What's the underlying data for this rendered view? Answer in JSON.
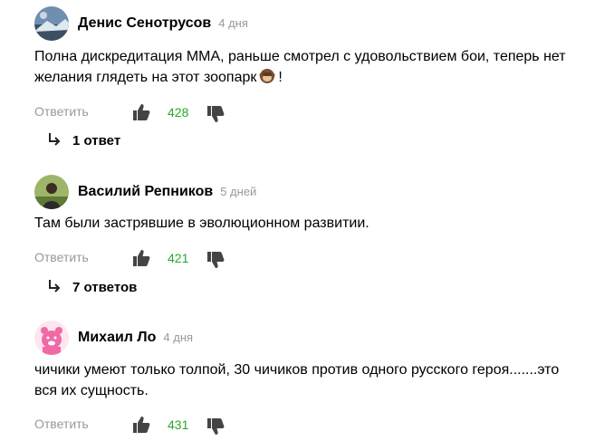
{
  "comments": [
    {
      "author": "Денис Сенотрусов",
      "time": "4 дня",
      "text": "Полна дискредитация ММА, раньше смотрел с удовольствием бои, теперь нет желания глядеть на этот зоопарк",
      "text_suffix": "!",
      "emoji": "monkey-emoji",
      "reply_label": "Ответить",
      "likes": "428",
      "replies_label": "1 ответ"
    },
    {
      "author": "Василий Репников",
      "time": "5 дней",
      "text": "Там были застрявшие в эволюционном развитии.",
      "reply_label": "Ответить",
      "likes": "421",
      "replies_label": "7 ответов"
    },
    {
      "author": "Михаил Ло",
      "time": "4 дня",
      "text": "чичики умеют только толпой, 30 чичиков против одного русского героя.......это вся их сущность.",
      "reply_label": "Ответить",
      "likes": "431"
    }
  ],
  "colors": {
    "likes": "#2aa82a",
    "muted": "#999999",
    "icon": "#444444"
  },
  "icons": {
    "like": "thumbs-up-icon",
    "dislike": "thumbs-down-icon",
    "replies": "reply-arrow-icon"
  }
}
